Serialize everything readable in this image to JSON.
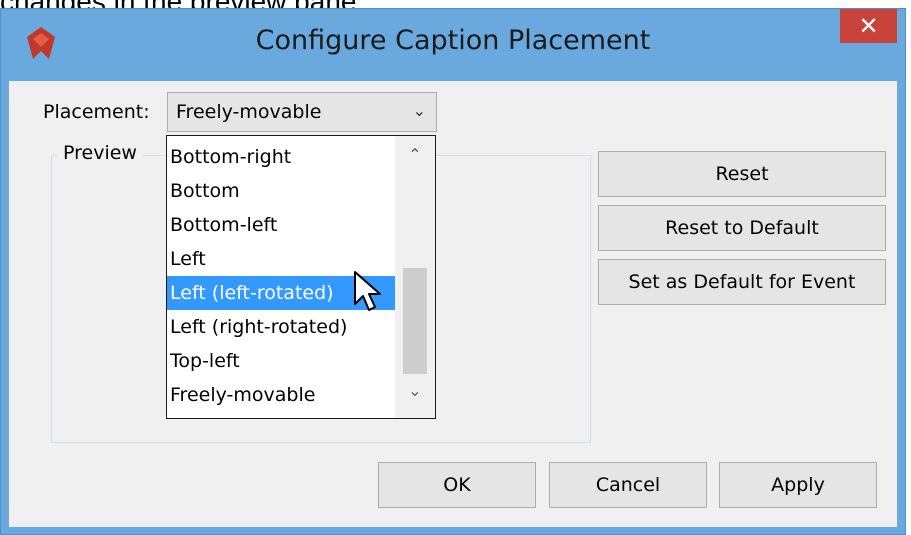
{
  "background": {
    "partial_text": "changes in the preview pane."
  },
  "window": {
    "title": "Configure Caption Placement",
    "close_glyph": "✕",
    "app_icon": "visual-paradigm-logo-icon",
    "title_bar_color": "#6aa9de",
    "close_color": "#c7433b"
  },
  "placement": {
    "label": "Placement:",
    "selected": "Freely-movable",
    "arrow_icon": "chevron-down-icon"
  },
  "preview": {
    "label": "Preview"
  },
  "side_buttons": {
    "reset": "Reset",
    "reset_default": "Reset to Default",
    "set_default": "Set as Default for Event"
  },
  "footer_buttons": {
    "ok": "OK",
    "cancel": "Cancel",
    "apply": "Apply"
  },
  "dropdown": {
    "items": [
      "Bottom-right",
      "Bottom",
      "Bottom-left",
      "Left",
      "Left (left-rotated)",
      "Left (right-rotated)",
      "Top-left",
      "Freely-movable"
    ],
    "highlighted_index": 4,
    "highlight_color": "#3399ff",
    "scroll_up_icon": "chevron-up-icon",
    "scroll_down_icon": "chevron-down-icon"
  },
  "cursor": {
    "icon": "pointer-arrow-icon"
  }
}
